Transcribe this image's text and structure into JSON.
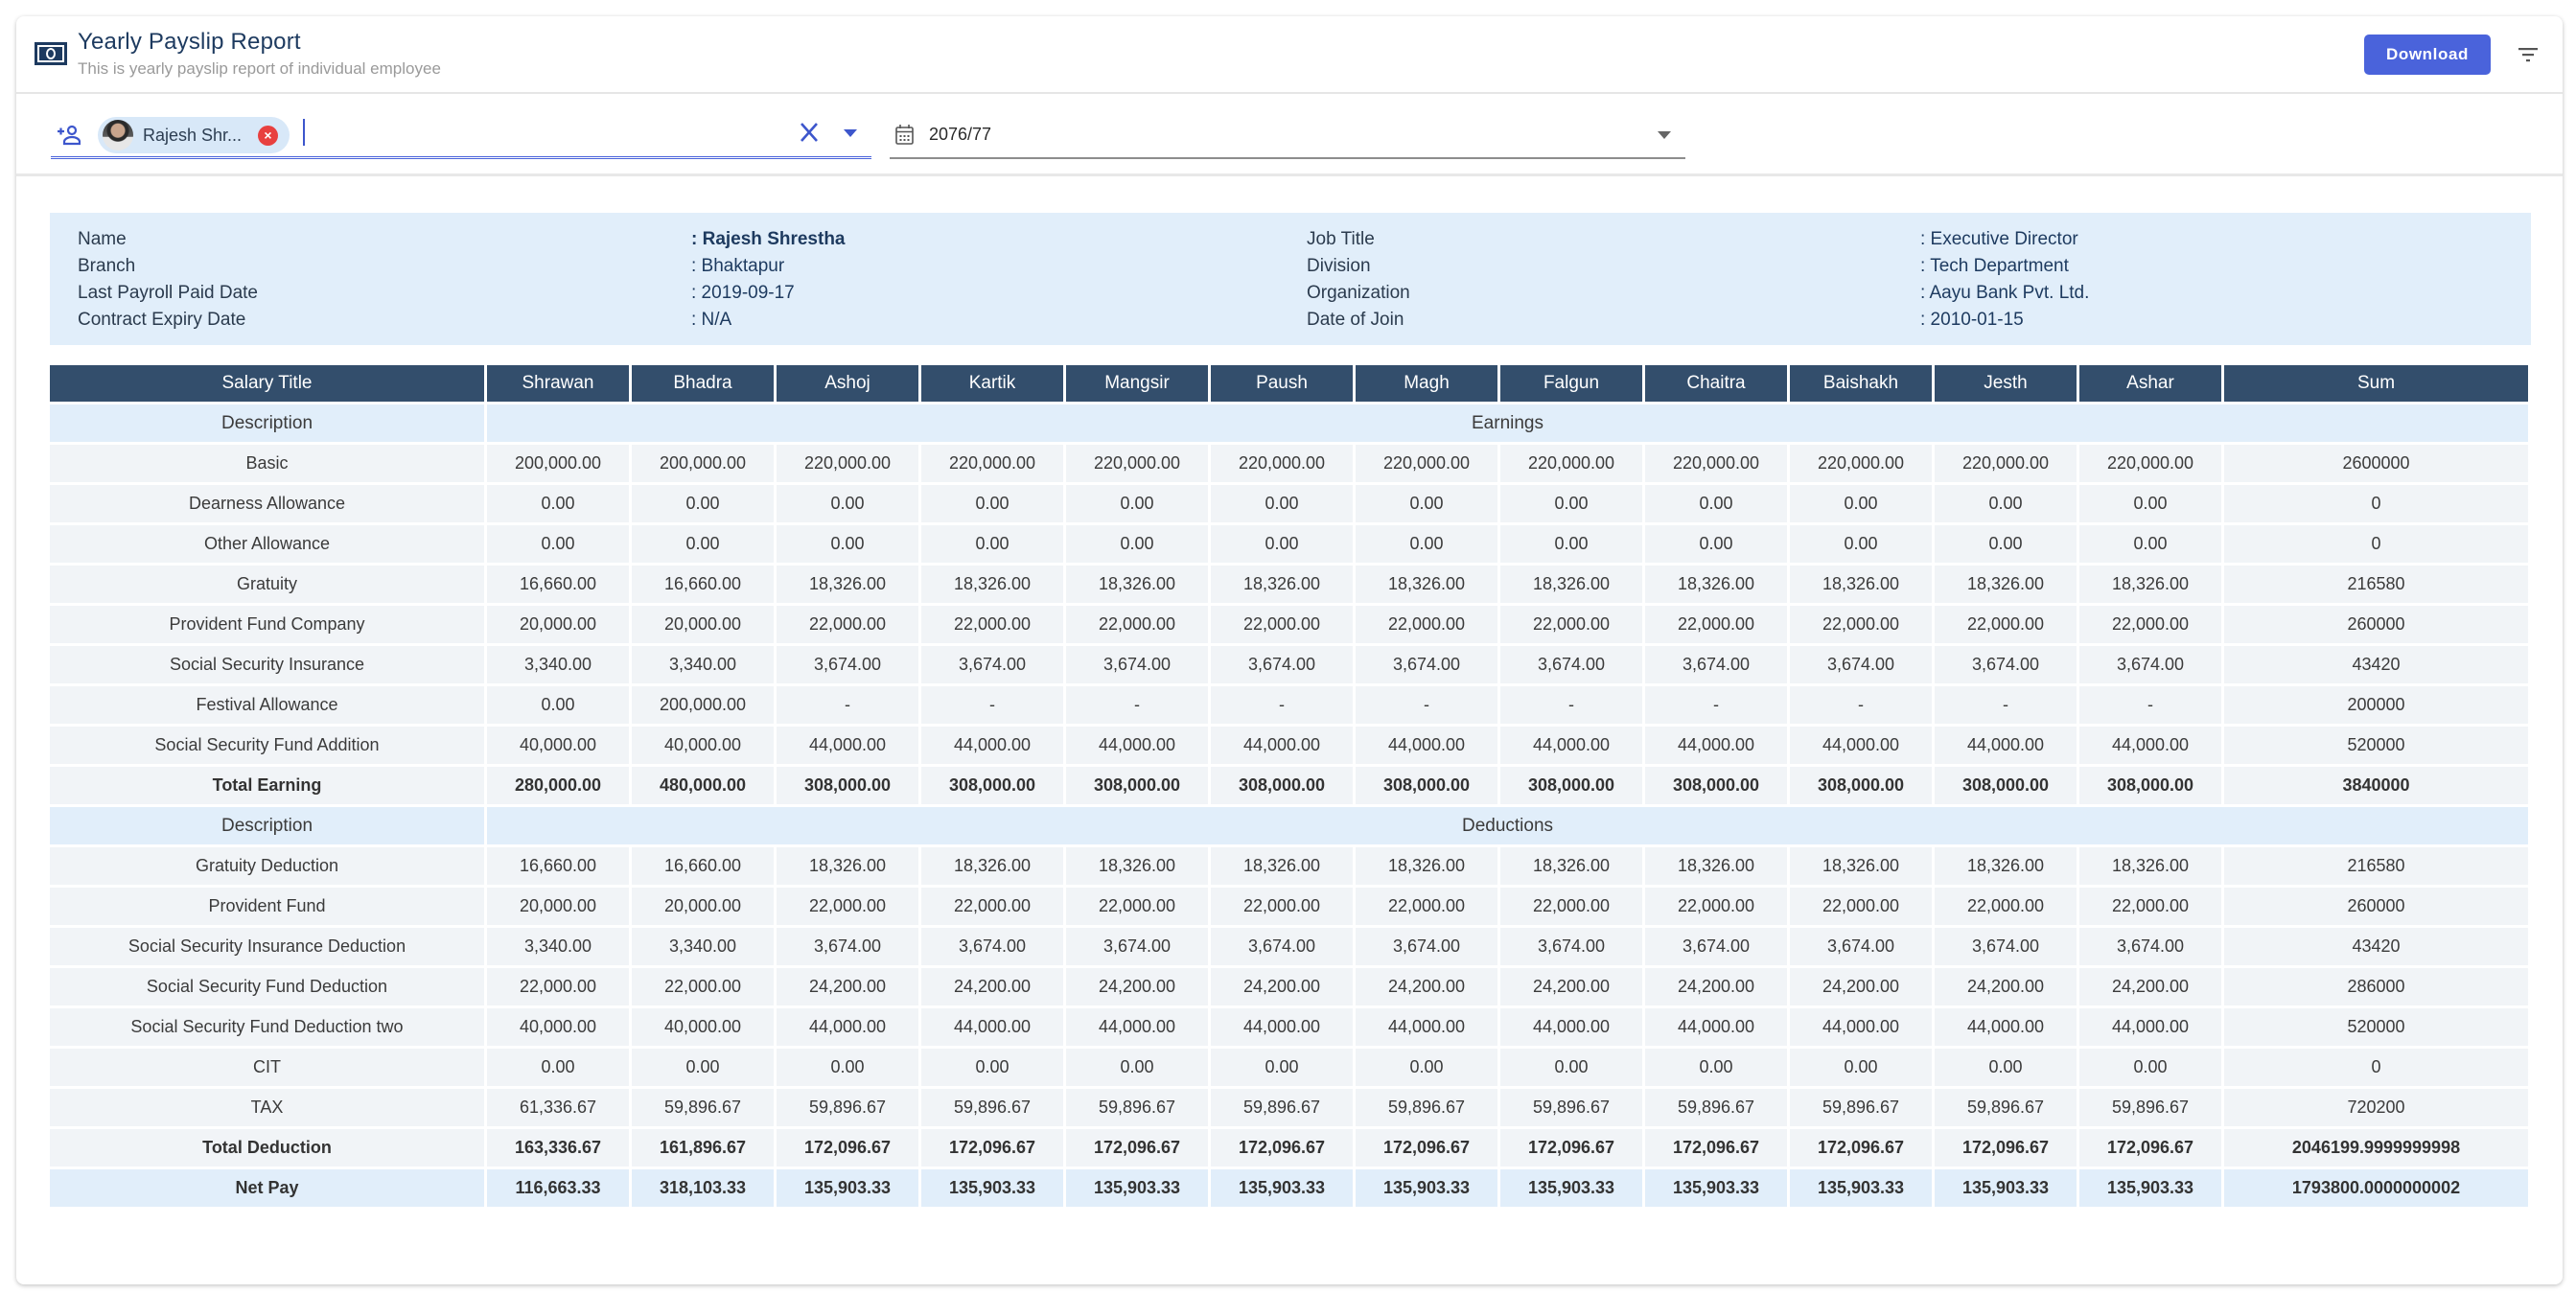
{
  "header": {
    "icon": "money-bill-icon",
    "title": "Yearly Payslip Report",
    "subtitle": "This is yearly payslip report of individual employee",
    "download_label": "Download",
    "filter_icon": "filter-icon"
  },
  "filters": {
    "employee": {
      "icon": "add-person-icon",
      "selected_chip_label": "Rajesh Shr...",
      "clear_icon": "close-x-icon",
      "dropdown_icon": "caret-down-icon",
      "accent_color": "#4a63db"
    },
    "fiscal_year": {
      "icon": "calendar-icon",
      "value": "2076/77",
      "dropdown_icon": "caret-down-icon"
    }
  },
  "employee_info": {
    "left": [
      {
        "label": "Name",
        "value": ": Rajesh Shrestha",
        "bold": true
      },
      {
        "label": "Branch",
        "value": ": Bhaktapur"
      },
      {
        "label": "Last Payroll Paid Date",
        "value": ": 2019-09-17"
      },
      {
        "label": "Contract Expiry Date",
        "value": ": N/A"
      }
    ],
    "right": [
      {
        "label": "Job Title",
        "value": ": Executive Director"
      },
      {
        "label": "Division",
        "value": ": Tech Department"
      },
      {
        "label": "Organization",
        "value": ": Aayu Bank Pvt. Ltd."
      },
      {
        "label": "Date of Join",
        "value": ": 2010-01-15"
      }
    ]
  },
  "table": {
    "header": [
      "Salary Title",
      "Shrawan",
      "Bhadra",
      "Ashoj",
      "Kartik",
      "Mangsir",
      "Paush",
      "Magh",
      "Falgun",
      "Chaitra",
      "Baishakh",
      "Jesth",
      "Ashar",
      "Sum"
    ],
    "earnings_section": {
      "description_label": "Description",
      "section_label": "Earnings"
    },
    "earnings": [
      {
        "title": "Basic",
        "values": [
          "200,000.00",
          "200,000.00",
          "220,000.00",
          "220,000.00",
          "220,000.00",
          "220,000.00",
          "220,000.00",
          "220,000.00",
          "220,000.00",
          "220,000.00",
          "220,000.00",
          "220,000.00"
        ],
        "sum": "2600000"
      },
      {
        "title": "Dearness Allowance",
        "values": [
          "0.00",
          "0.00",
          "0.00",
          "0.00",
          "0.00",
          "0.00",
          "0.00",
          "0.00",
          "0.00",
          "0.00",
          "0.00",
          "0.00"
        ],
        "sum": "0"
      },
      {
        "title": "Other Allowance",
        "values": [
          "0.00",
          "0.00",
          "0.00",
          "0.00",
          "0.00",
          "0.00",
          "0.00",
          "0.00",
          "0.00",
          "0.00",
          "0.00",
          "0.00"
        ],
        "sum": "0"
      },
      {
        "title": "Gratuity",
        "values": [
          "16,660.00",
          "16,660.00",
          "18,326.00",
          "18,326.00",
          "18,326.00",
          "18,326.00",
          "18,326.00",
          "18,326.00",
          "18,326.00",
          "18,326.00",
          "18,326.00",
          "18,326.00"
        ],
        "sum": "216580"
      },
      {
        "title": "Provident Fund Company",
        "values": [
          "20,000.00",
          "20,000.00",
          "22,000.00",
          "22,000.00",
          "22,000.00",
          "22,000.00",
          "22,000.00",
          "22,000.00",
          "22,000.00",
          "22,000.00",
          "22,000.00",
          "22,000.00"
        ],
        "sum": "260000"
      },
      {
        "title": "Social Security Insurance",
        "values": [
          "3,340.00",
          "3,340.00",
          "3,674.00",
          "3,674.00",
          "3,674.00",
          "3,674.00",
          "3,674.00",
          "3,674.00",
          "3,674.00",
          "3,674.00",
          "3,674.00",
          "3,674.00"
        ],
        "sum": "43420"
      },
      {
        "title": "Festival Allowance",
        "values": [
          "0.00",
          "200,000.00",
          "-",
          "-",
          "-",
          "-",
          "-",
          "-",
          "-",
          "-",
          "-",
          "-"
        ],
        "sum": "200000"
      },
      {
        "title": "Social Security Fund Addition",
        "values": [
          "40,000.00",
          "40,000.00",
          "44,000.00",
          "44,000.00",
          "44,000.00",
          "44,000.00",
          "44,000.00",
          "44,000.00",
          "44,000.00",
          "44,000.00",
          "44,000.00",
          "44,000.00"
        ],
        "sum": "520000"
      }
    ],
    "total_earning": {
      "title": "Total Earning",
      "values": [
        "280,000.00",
        "480,000.00",
        "308,000.00",
        "308,000.00",
        "308,000.00",
        "308,000.00",
        "308,000.00",
        "308,000.00",
        "308,000.00",
        "308,000.00",
        "308,000.00",
        "308,000.00"
      ],
      "sum": "3840000"
    },
    "deductions_section": {
      "description_label": "Description",
      "section_label": "Deductions"
    },
    "deductions": [
      {
        "title": "Gratuity Deduction",
        "values": [
          "16,660.00",
          "16,660.00",
          "18,326.00",
          "18,326.00",
          "18,326.00",
          "18,326.00",
          "18,326.00",
          "18,326.00",
          "18,326.00",
          "18,326.00",
          "18,326.00",
          "18,326.00"
        ],
        "sum": "216580"
      },
      {
        "title": "Provident Fund",
        "values": [
          "20,000.00",
          "20,000.00",
          "22,000.00",
          "22,000.00",
          "22,000.00",
          "22,000.00",
          "22,000.00",
          "22,000.00",
          "22,000.00",
          "22,000.00",
          "22,000.00",
          "22,000.00"
        ],
        "sum": "260000"
      },
      {
        "title": "Social Security Insurance Deduction",
        "values": [
          "3,340.00",
          "3,340.00",
          "3,674.00",
          "3,674.00",
          "3,674.00",
          "3,674.00",
          "3,674.00",
          "3,674.00",
          "3,674.00",
          "3,674.00",
          "3,674.00",
          "3,674.00"
        ],
        "sum": "43420"
      },
      {
        "title": "Social Security Fund Deduction",
        "values": [
          "22,000.00",
          "22,000.00",
          "24,200.00",
          "24,200.00",
          "24,200.00",
          "24,200.00",
          "24,200.00",
          "24,200.00",
          "24,200.00",
          "24,200.00",
          "24,200.00",
          "24,200.00"
        ],
        "sum": "286000"
      },
      {
        "title": "Social Security Fund Deduction two",
        "values": [
          "40,000.00",
          "40,000.00",
          "44,000.00",
          "44,000.00",
          "44,000.00",
          "44,000.00",
          "44,000.00",
          "44,000.00",
          "44,000.00",
          "44,000.00",
          "44,000.00",
          "44,000.00"
        ],
        "sum": "520000"
      },
      {
        "title": "CIT",
        "values": [
          "0.00",
          "0.00",
          "0.00",
          "0.00",
          "0.00",
          "0.00",
          "0.00",
          "0.00",
          "0.00",
          "0.00",
          "0.00",
          "0.00"
        ],
        "sum": "0"
      },
      {
        "title": "TAX",
        "values": [
          "61,336.67",
          "59,896.67",
          "59,896.67",
          "59,896.67",
          "59,896.67",
          "59,896.67",
          "59,896.67",
          "59,896.67",
          "59,896.67",
          "59,896.67",
          "59,896.67",
          "59,896.67"
        ],
        "sum": "720200"
      }
    ],
    "total_deduction": {
      "title": "Total Deduction",
      "values": [
        "163,336.67",
        "161,896.67",
        "172,096.67",
        "172,096.67",
        "172,096.67",
        "172,096.67",
        "172,096.67",
        "172,096.67",
        "172,096.67",
        "172,096.67",
        "172,096.67",
        "172,096.67"
      ],
      "sum": "2046199.9999999998"
    },
    "net_pay": {
      "title": "Net Pay",
      "values": [
        "116,663.33",
        "318,103.33",
        "135,903.33",
        "135,903.33",
        "135,903.33",
        "135,903.33",
        "135,903.33",
        "135,903.33",
        "135,903.33",
        "135,903.33",
        "135,903.33",
        "135,903.33"
      ],
      "sum": "1793800.0000000002"
    }
  }
}
